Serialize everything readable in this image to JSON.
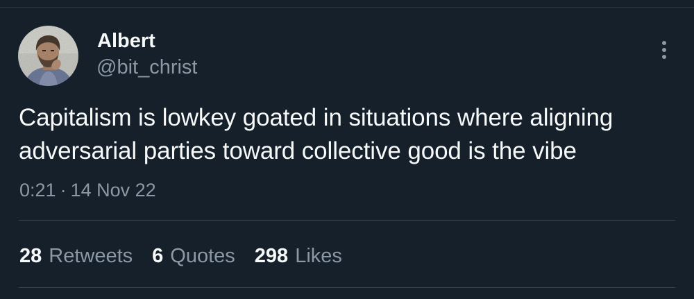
{
  "author": {
    "display_name": "Albert",
    "handle": "@bit_christ",
    "avatar_icon": "profile-photo"
  },
  "more_icon": "more-vertical-icon",
  "tweet": {
    "text_lines": [
      "Capitalism is lowkey goated in situations where aligning",
      "adversarial parties toward collective good is the vibe"
    ],
    "time": "0:21",
    "separator": "·",
    "date": "14 Nov 22"
  },
  "stats": {
    "retweets": {
      "count": "28",
      "label": "Retweets"
    },
    "quotes": {
      "count": "6",
      "label": "Quotes"
    },
    "likes": {
      "count": "298",
      "label": "Likes"
    }
  },
  "colors": {
    "background": "#15202b",
    "primary_text": "#f7f9f9",
    "secondary_text": "#8b98a5",
    "divider": "#38444d"
  }
}
